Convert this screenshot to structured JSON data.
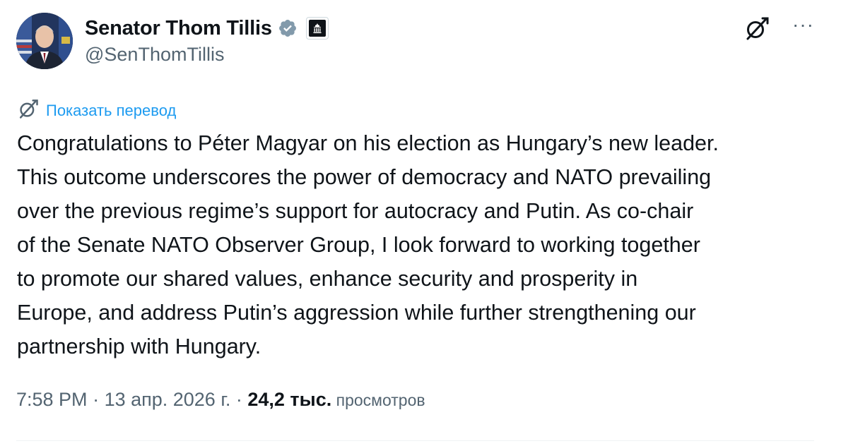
{
  "author": {
    "display_name": "Senator Thom Tillis",
    "handle": "@SenThomTillis",
    "verified_icon": "verified-badge-icon",
    "affiliation_icon": "capitol-building-icon"
  },
  "actions": {
    "grok_icon": "grok-icon",
    "more_label": "···"
  },
  "translate": {
    "icon": "grok-icon",
    "label": "Показать перевод"
  },
  "tweet": {
    "text": "Congratulations to Péter Magyar on his election as Hungary’s new leader.\nThis outcome underscores the power of democracy and NATO prevailing\nover the previous regime’s support for autocracy and Putin. As co-chair\nof the Senate NATO Observer Group, I look forward to working together\nto promote our shared values, enhance security and prosperity in\nEurope, and address Putin’s aggression while further strengthening our\npartnership with Hungary."
  },
  "meta": {
    "time": "7:58 PM",
    "sep1": " · ",
    "date": "13 апр. 2026 г.",
    "sep2": " · ",
    "views_count": "24,2 тыс.",
    "views_label": " просмотров"
  },
  "colors": {
    "link": "#1d9bf0",
    "secondary": "#536471",
    "primary": "#0f1419",
    "verified": "#829aab"
  }
}
